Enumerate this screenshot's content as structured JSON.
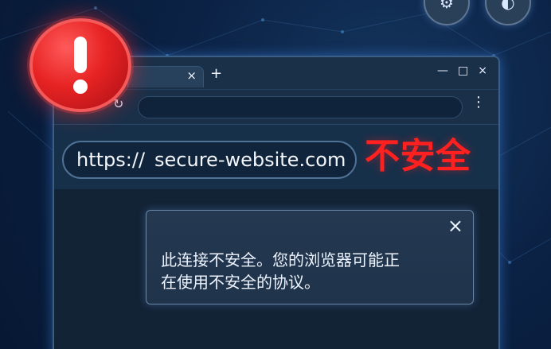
{
  "browser": {
    "tab_close": "×",
    "new_tab": "+",
    "window_controls": {
      "minimize": "—",
      "maximize": "□",
      "close": "×"
    },
    "toolbar": {
      "back": "←",
      "forward": "→",
      "refresh": "↻",
      "menu": "⋮"
    }
  },
  "page": {
    "url_protocol": "https://",
    "url_domain": "secure-website.com",
    "insecure_label": "不安全"
  },
  "popup": {
    "close": "×",
    "message_line_1": "此连接不安全。您的浏览器可能正",
    "message_line_2": "在使用不安全的协议。"
  },
  "icons": {
    "warning_badge": "exclamation-icon",
    "top_left_circle": "gear-icon",
    "top_right_circle": "shield-icon"
  },
  "colors": {
    "background": "#0b2245",
    "browser_frame": "#3b5e87",
    "danger": "#ff2020"
  }
}
